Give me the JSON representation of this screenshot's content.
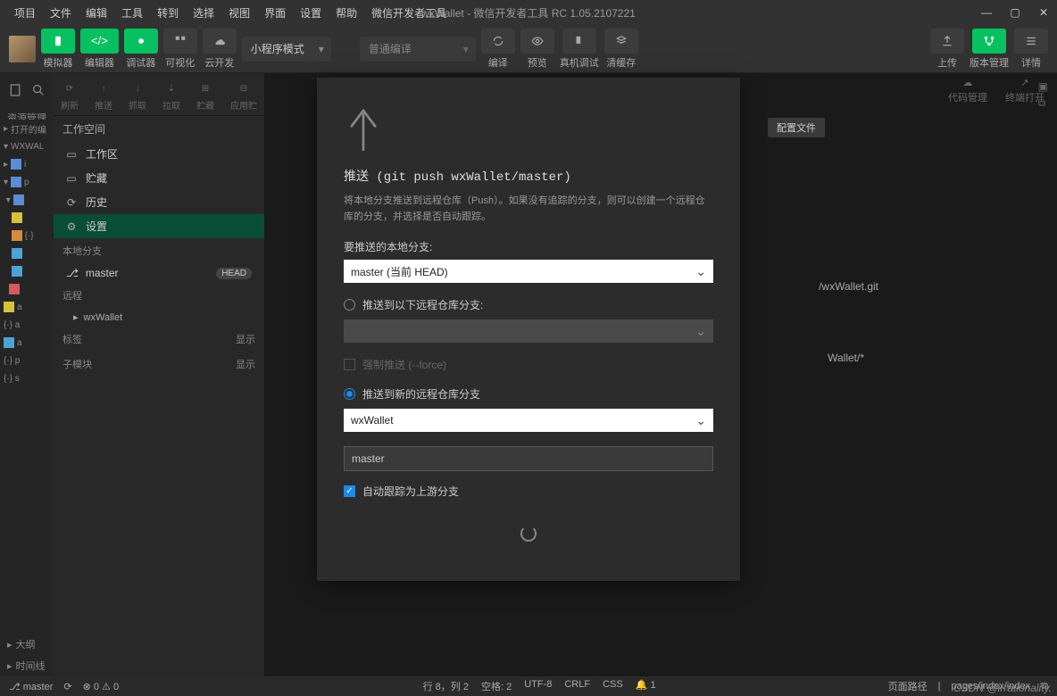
{
  "menubar": {
    "items": [
      "项目",
      "文件",
      "编辑",
      "工具",
      "转到",
      "选择",
      "视图",
      "界面",
      "设置",
      "帮助",
      "微信开发者工具"
    ],
    "title": "wxWallet - 微信开发者工具 RC 1.05.2107221"
  },
  "toolbar": {
    "simulator": "模拟器",
    "editor": "编辑器",
    "debugger": "调试器",
    "visual": "可视化",
    "cloud": "云开发",
    "mode": "小程序模式",
    "compile_placeholder": "普通编译",
    "compile": "编译",
    "preview": "预览",
    "realdebug": "真机调试",
    "clearcache": "清缓存",
    "upload": "上传",
    "version": "版本管理",
    "detail": "详情"
  },
  "leftRail": {
    "label": "资源管理"
  },
  "explorer": {
    "opened": "打开的编",
    "project": "WXWAL"
  },
  "git_toolbar": {
    "refresh": "刷新",
    "push": "推送",
    "fetch": "抓取",
    "pull": "拉取",
    "stash": "贮藏",
    "apply": "应用贮"
  },
  "workspace": {
    "title": "工作空间",
    "workzone": "工作区",
    "stash": "贮藏",
    "history": "历史",
    "settings": "设置"
  },
  "local_branch": {
    "title": "本地分支",
    "master": "master",
    "head_badge": "HEAD"
  },
  "remote_section": {
    "title": "远程",
    "wxwallet": "wxWallet"
  },
  "tags_section": {
    "title": "标签",
    "show": "显示"
  },
  "submodule_section": {
    "title": "子模块",
    "show": "显示"
  },
  "right_actions": {
    "code_mgmt": "代码管理",
    "terminal_open": "终端打开"
  },
  "config_btn": "配置文件",
  "remote_url": "/wxWallet.git",
  "remote_spec": "Wallet/*",
  "dialog": {
    "title": "推送 (git push wxWallet/master)",
    "desc": "将本地分支推送到远程仓库（Push）。如果没有追踪的分支，则可以创建一个远程仓库的分支，并选择是否自动跟踪。",
    "local_branch_label": "要推送的本地分支:",
    "local_branch_value": "master (当前 HEAD)",
    "push_remote_label": "推送到以下远程仓库分支:",
    "force_push": "强制推送 (--force)",
    "push_new_label": "推送到新的远程仓库分支",
    "remote_select": "wxWallet",
    "branch_input": "master",
    "auto_track": "自动跟踪为上游分支"
  },
  "bottom": {
    "outline": "大纲",
    "timeline": "时间线"
  },
  "statusbar": {
    "branch": "master",
    "errors": "0",
    "warnings": "0",
    "cursor": "行 8，列 2",
    "spaces": "空格: 2",
    "encoding": "UTF-8",
    "eol": "CRLF",
    "lang": "CSS",
    "notif": "1",
    "pagepath_label": "页面路径",
    "pagepath": "pages/index/index"
  },
  "watermark": "CSDN @irrationality."
}
